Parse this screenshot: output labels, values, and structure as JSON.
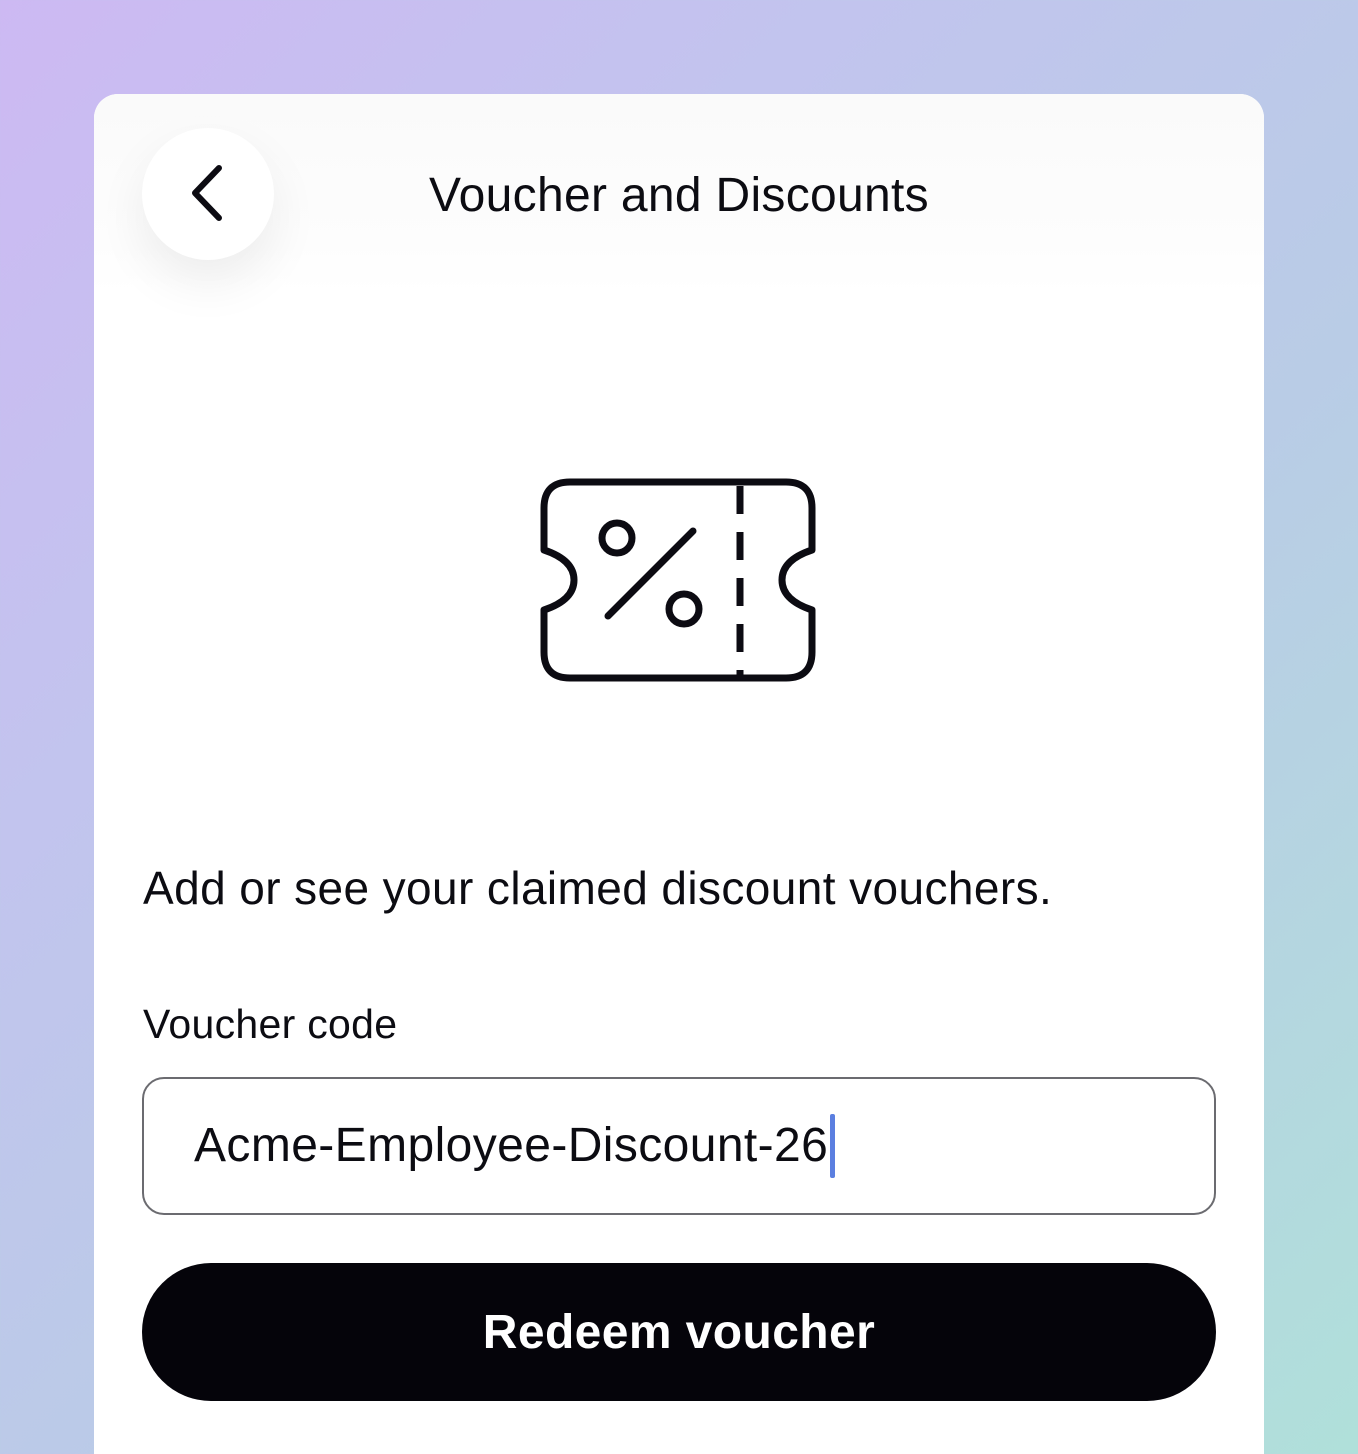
{
  "header": {
    "title": "Voucher and Discounts",
    "back_icon": "chevron-left-icon"
  },
  "illustration": {
    "icon": "discount-ticket-icon",
    "stroke_color": "#0c0b12"
  },
  "main": {
    "description": "Add or see your claimed discount vouchers.",
    "voucher_field": {
      "label": "Voucher code",
      "value": "Acme-Employee-Discount-26"
    },
    "redeem_button": {
      "label": "Redeem voucher"
    }
  },
  "colors": {
    "button_background": "#05040a",
    "caret": "#5b7fe0"
  }
}
